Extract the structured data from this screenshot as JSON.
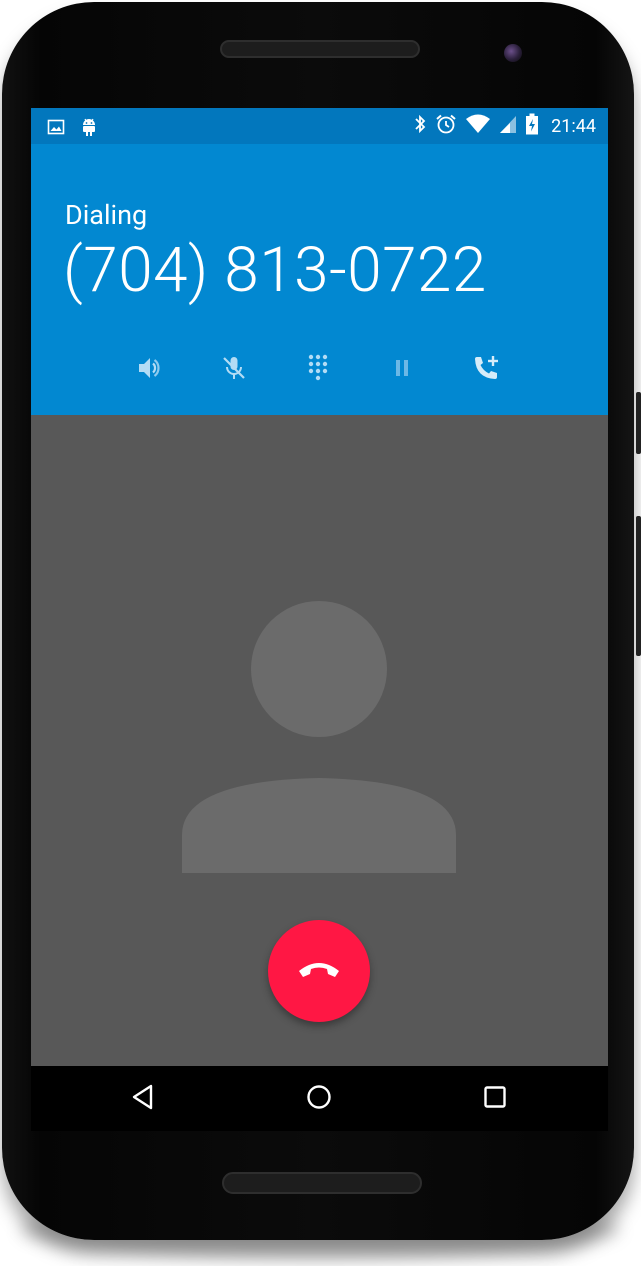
{
  "status_bar": {
    "time": "21:44",
    "left_icons": [
      "image-icon",
      "android-icon"
    ],
    "right_icons": [
      "bluetooth-icon",
      "alarm-icon",
      "wifi-icon",
      "signal-icon",
      "battery-charging-icon"
    ],
    "background": "#0277bd"
  },
  "call": {
    "state": "Dialing",
    "number": "(704) 813-0722",
    "header_color": "#0288d1",
    "controls": [
      {
        "name": "speaker",
        "icon": "speaker-icon"
      },
      {
        "name": "mute",
        "icon": "mic-off-icon"
      },
      {
        "name": "dialpad",
        "icon": "dialpad-icon"
      },
      {
        "name": "hold",
        "icon": "pause-icon"
      },
      {
        "name": "add-call",
        "icon": "add-call-icon"
      }
    ]
  },
  "contact": {
    "avatar": "person-placeholder-icon",
    "background": "#585858"
  },
  "end_call": {
    "icon": "call-end-icon",
    "color": "#ff1744"
  },
  "nav": {
    "items": [
      "back-icon",
      "home-icon",
      "recents-icon"
    ]
  }
}
